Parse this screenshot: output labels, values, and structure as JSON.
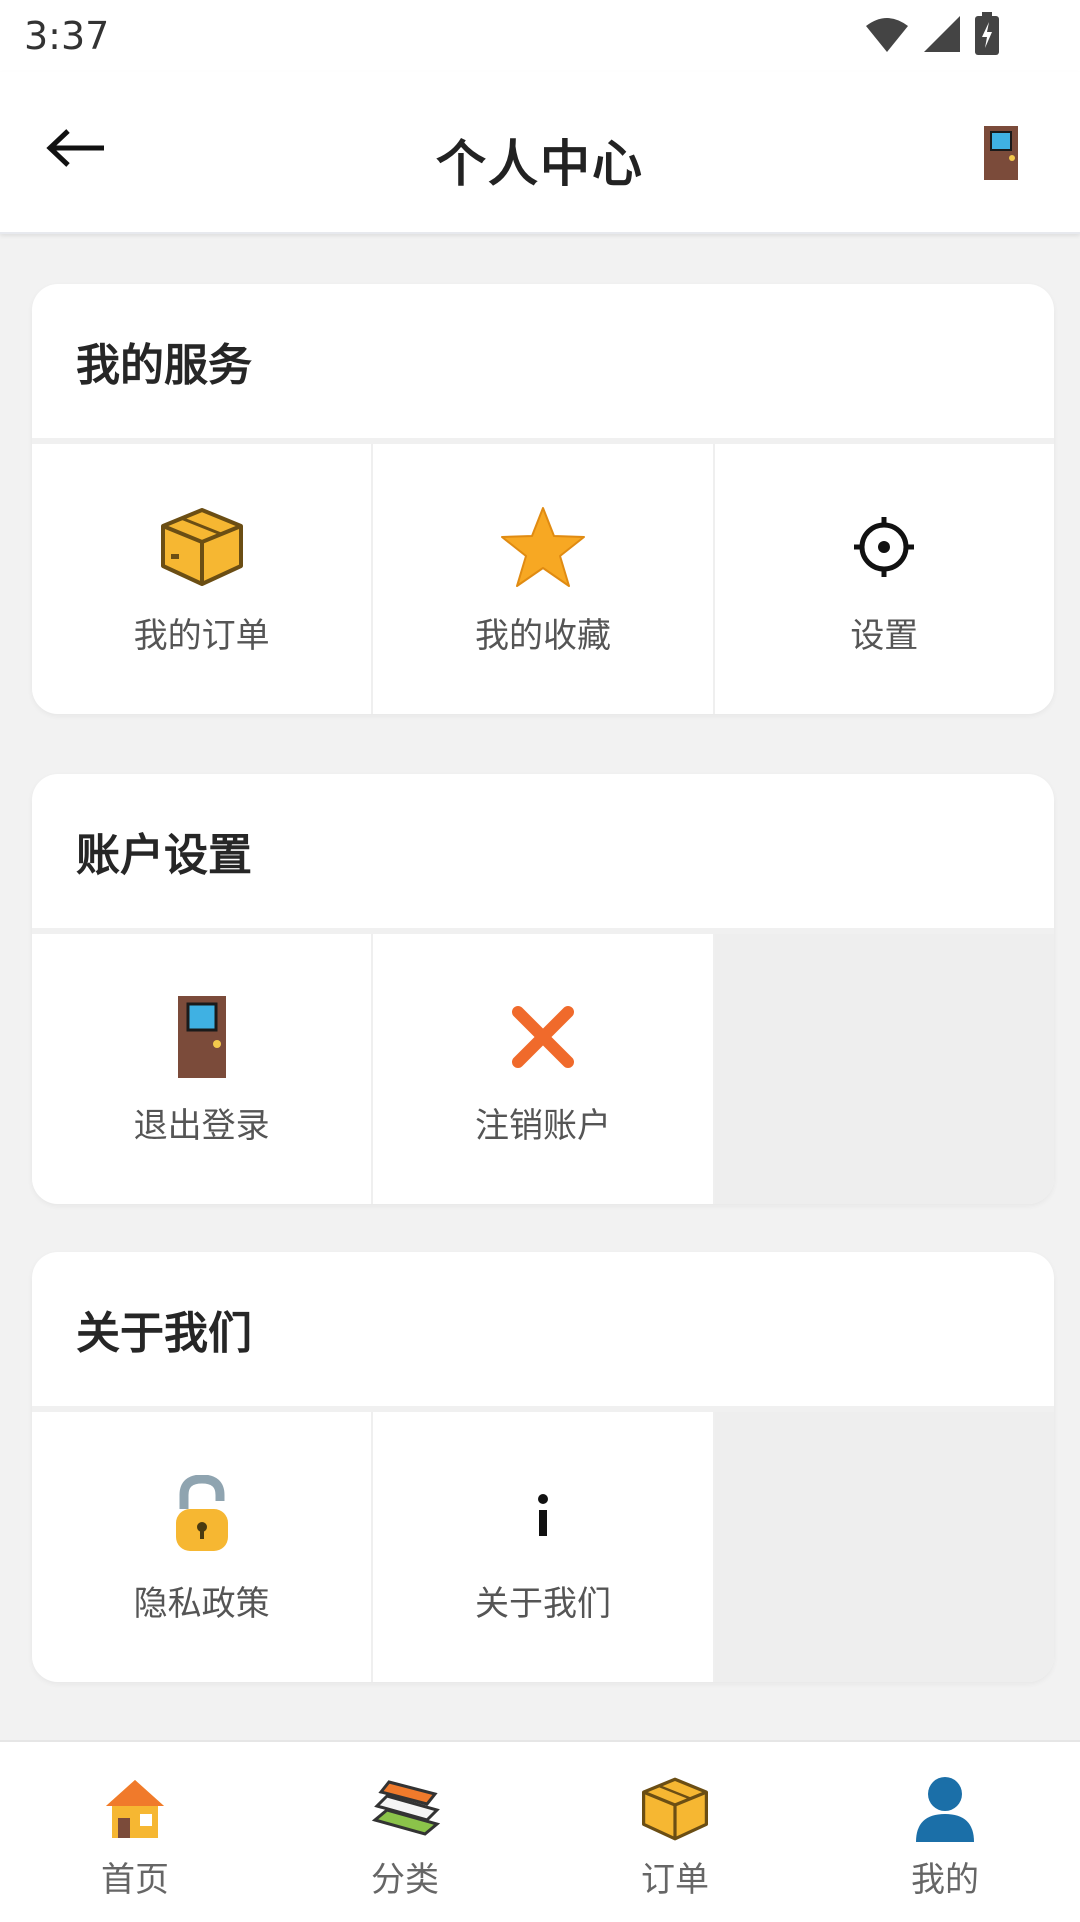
{
  "status_bar": {
    "time": "3:37",
    "icons": [
      "wifi-icon",
      "signal-icon",
      "battery-charging-icon"
    ]
  },
  "app_bar": {
    "back_icon": "back-arrow-icon",
    "title": "个人中心",
    "action_icon": "door-icon"
  },
  "sections": [
    {
      "title": "我的服务",
      "items": [
        {
          "label": "我的订单",
          "icon": "package-icon"
        },
        {
          "label": "我的收藏",
          "icon": "star-icon"
        },
        {
          "label": "设置",
          "icon": "gear-icon"
        }
      ]
    },
    {
      "title": "账户设置",
      "items": [
        {
          "label": "退出登录",
          "icon": "door-icon"
        },
        {
          "label": "注销账户",
          "icon": "cross-icon"
        }
      ]
    },
    {
      "title": "关于我们",
      "items": [
        {
          "label": "隐私政策",
          "icon": "lock-icon"
        },
        {
          "label": "关于我们",
          "icon": "info-icon"
        }
      ]
    }
  ],
  "bottom_nav": [
    {
      "label": "首页",
      "icon": "house-icon"
    },
    {
      "label": "分类",
      "icon": "books-icon"
    },
    {
      "label": "订单",
      "icon": "package-icon"
    },
    {
      "label": "我的",
      "icon": "person-icon",
      "active": true
    }
  ],
  "colors": {
    "background": "#f2f2f2",
    "card": "#ffffff",
    "star": "#f7a823",
    "cross": "#f06a2b",
    "door": "#7b4b3a",
    "person": "#1b6fa8"
  }
}
